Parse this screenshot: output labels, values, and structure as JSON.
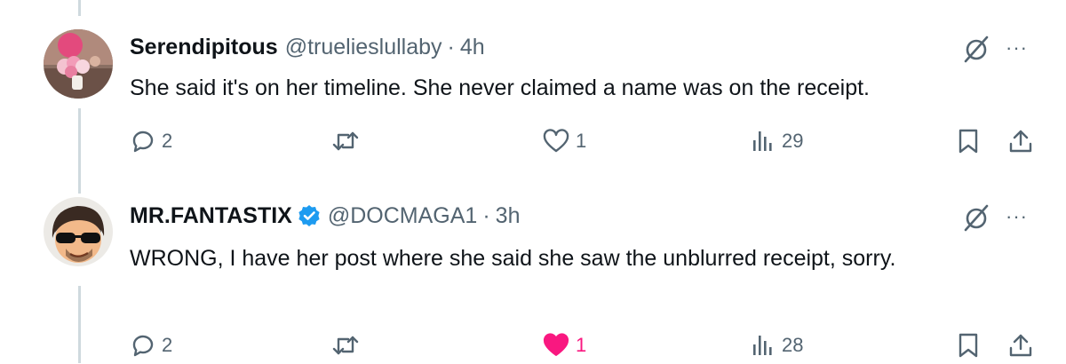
{
  "colors": {
    "text": "#0f1419",
    "muted": "#536471",
    "like": "#f91880",
    "verified": "#1d9bf0",
    "thread": "#cfd9de"
  },
  "tweets": [
    {
      "display_name": "Serendipitous",
      "handle": "@truelieslullaby",
      "separator": "·",
      "time": "4h",
      "verified": false,
      "text": "She said it's on her timeline. She never claimed a name was on the receipt.",
      "more": "···",
      "replies": "2",
      "retweets": "",
      "likes": "1",
      "liked": false,
      "views": "29"
    },
    {
      "display_name": "MR.FANTASTIX",
      "handle": "@DOCMAGA1",
      "separator": "·",
      "time": "3h",
      "verified": true,
      "text": "WRONG, I have her post where she said she saw the unblurred receipt, sorry.",
      "more": "···",
      "replies": "2",
      "retweets": "",
      "likes": "1",
      "liked": true,
      "views": "28"
    }
  ]
}
